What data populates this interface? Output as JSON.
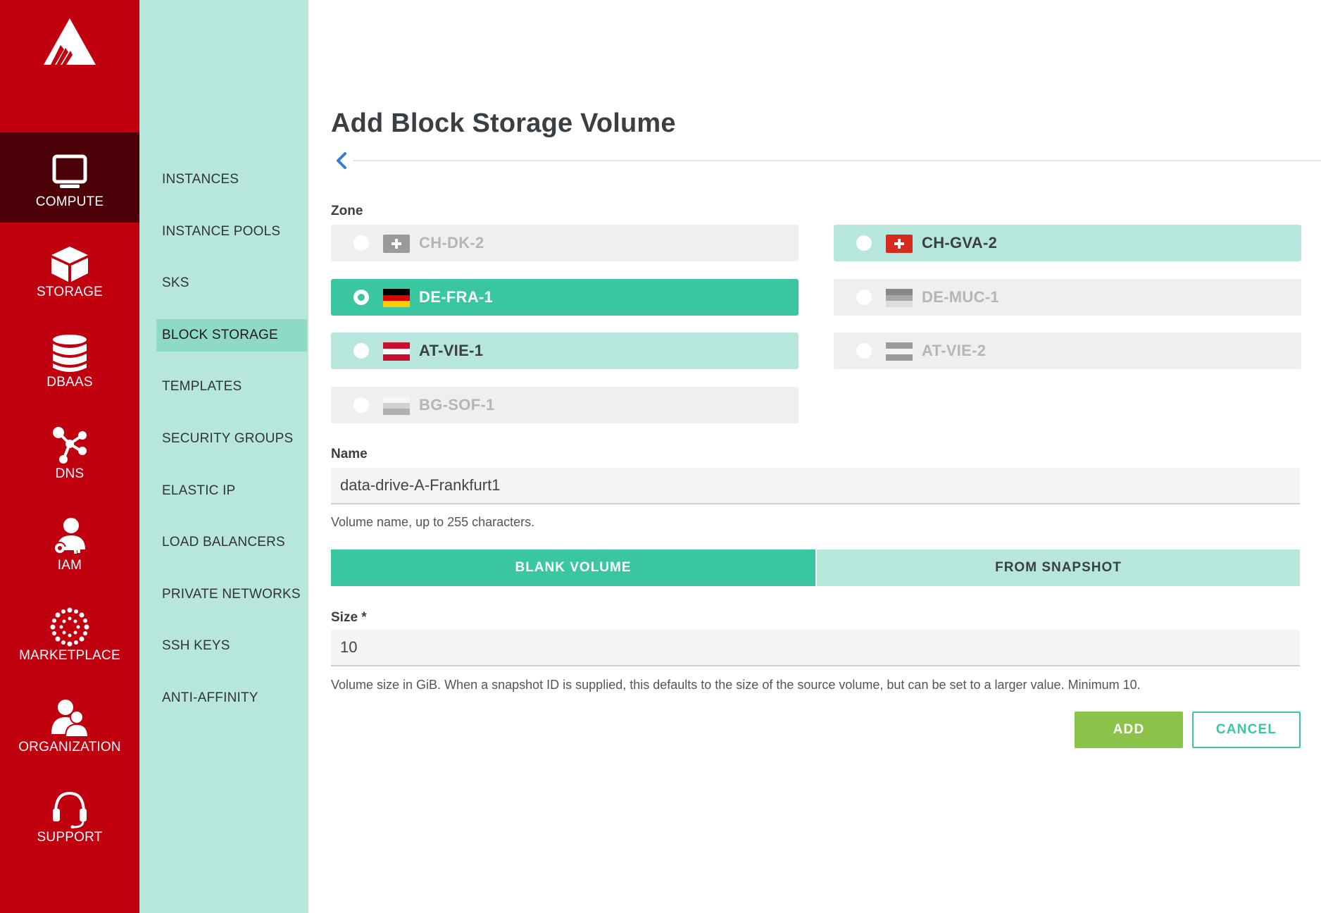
{
  "rail": {
    "items": [
      {
        "label": "COMPUTE",
        "icon": "monitor-icon"
      },
      {
        "label": "STORAGE",
        "icon": "cube-icon"
      },
      {
        "label": "DBAAS",
        "icon": "database-icon"
      },
      {
        "label": "DNS",
        "icon": "network-nodes-icon"
      },
      {
        "label": "IAM",
        "icon": "user-key-icon"
      },
      {
        "label": "MARKETPLACE",
        "icon": "dots-burst-icon"
      },
      {
        "label": "ORGANIZATION",
        "icon": "users-icon"
      },
      {
        "label": "SUPPORT",
        "icon": "headset-icon"
      }
    ],
    "active": "COMPUTE"
  },
  "subnav": {
    "items": [
      "INSTANCES",
      "INSTANCE POOLS",
      "SKS",
      "BLOCK STORAGE",
      "TEMPLATES",
      "SECURITY GROUPS",
      "ELASTIC IP",
      "LOAD BALANCERS",
      "PRIVATE NETWORKS",
      "SSH KEYS",
      "ANTI-AFFINITY"
    ],
    "active": "BLOCK STORAGE"
  },
  "page": {
    "title": "Add Block Storage Volume"
  },
  "form": {
    "zone_label": "Zone",
    "zones": [
      {
        "name": "CH-DK-2",
        "state": "disabled",
        "flag": "switzerland-flag-gray"
      },
      {
        "name": "CH-GVA-2",
        "state": "available",
        "flag": "switzerland-flag"
      },
      {
        "name": "DE-FRA-1",
        "state": "selected",
        "flag": "germany-flag"
      },
      {
        "name": "DE-MUC-1",
        "state": "disabled",
        "flag": "germany-flag-gray"
      },
      {
        "name": "AT-VIE-1",
        "state": "available",
        "flag": "austria-flag"
      },
      {
        "name": "AT-VIE-2",
        "state": "disabled",
        "flag": "austria-flag-gray"
      },
      {
        "name": "BG-SOF-1",
        "state": "disabled",
        "flag": "bulgaria-flag-gray"
      }
    ],
    "name_label": "Name",
    "name_value": "data-drive-A-Frankfurt1",
    "name_help": "Volume name, up to 255 characters.",
    "source_tabs": [
      "BLANK VOLUME",
      "FROM SNAPSHOT"
    ],
    "source_selected": "BLANK VOLUME",
    "size_label": "Size *",
    "size_value": "10",
    "size_help": "Volume size in GiB. When a snapshot ID is supplied, this defaults to the size of the source volume, but can be set to a larger value. Minimum 10.",
    "add_label": "ADD",
    "cancel_label": "CANCEL"
  },
  "colors": {
    "rail": "#c0000f",
    "rail_active": "#4a0006",
    "subnav": "#b7e7dc",
    "subnav_active": "#8fd9c7",
    "selected": "#3bc6a2",
    "available": "#b7e7dc",
    "disabled": "#efefef",
    "add_button": "#8bc34a"
  }
}
